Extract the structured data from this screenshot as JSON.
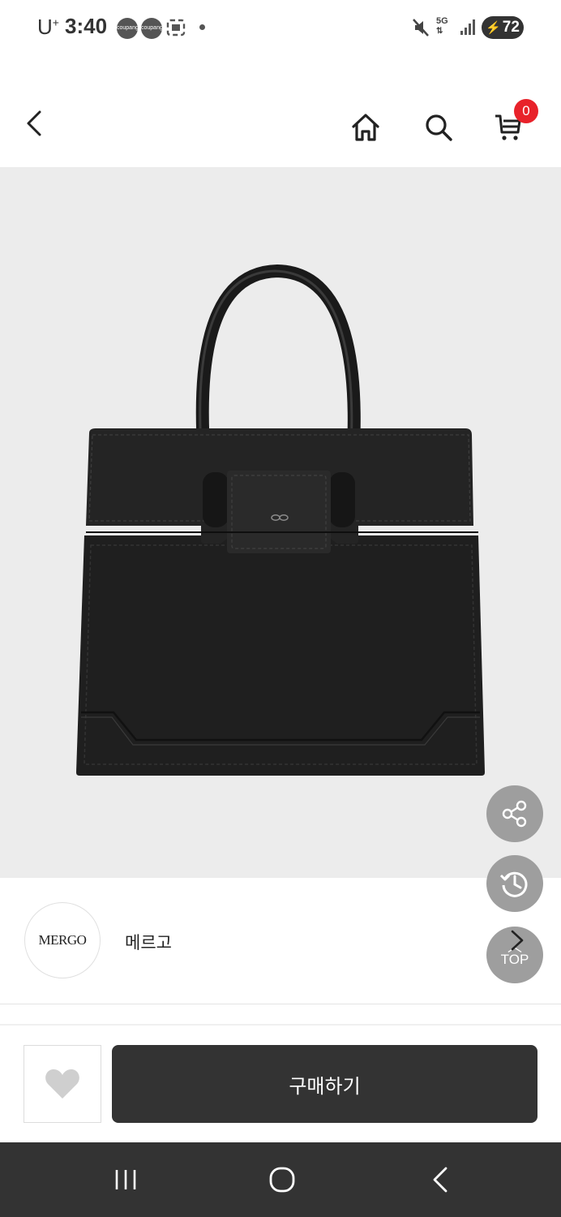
{
  "status_bar": {
    "carrier": "U",
    "carrier_sup": "+",
    "time": "3:40",
    "badge_1": "coupang eats",
    "badge_2": "coupang eats",
    "network": "5G",
    "battery": "72"
  },
  "header": {
    "back_icon": "chevron-left-icon",
    "home_icon": "home-icon",
    "search_icon": "search-icon",
    "cart_icon": "cart-icon",
    "cart_count": "0"
  },
  "product": {
    "image_subject": "black leather tote bag",
    "background_color": "#ececec"
  },
  "floating": {
    "share_icon": "share-icon",
    "recent_icon": "history-icon",
    "top_label": "TOP"
  },
  "brand": {
    "logo_text": "MERGO",
    "name": "메르고"
  },
  "actions": {
    "wishlist_icon": "heart-icon",
    "buy_label": "구매하기"
  },
  "colors": {
    "accent_badge": "#e8222a",
    "buy_button": "#333333",
    "fab": "#9e9e9e",
    "nav_bar": "#333333"
  }
}
